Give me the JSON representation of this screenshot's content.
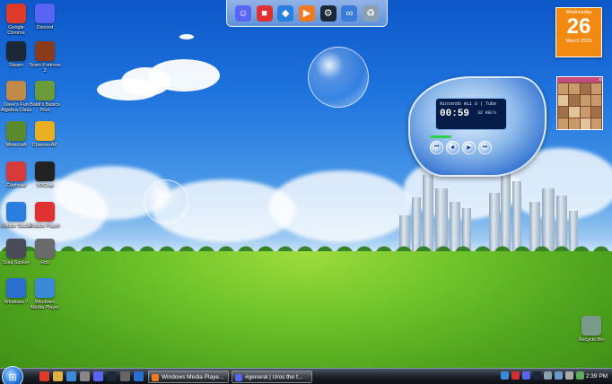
{
  "desktop_icons": [
    {
      "label": "Google Chrome",
      "icon": "chrome-icon",
      "color": "#dd3a2a"
    },
    {
      "label": "Discord",
      "icon": "discord-icon",
      "color": "#5865f2"
    },
    {
      "label": "Steam",
      "icon": "steam-icon",
      "color": "#1b2838"
    },
    {
      "label": "Team Fortress 2",
      "icon": "tf2-icon",
      "color": "#8b3a1a"
    },
    {
      "label": "Dave's Fun Algebra Class",
      "icon": "daves-algebra-icon",
      "color": "#c08a4a"
    },
    {
      "label": "Baldi's Basics Plus",
      "icon": "baldi-icon",
      "color": "#6b9a3a"
    },
    {
      "label": "Minecraft",
      "icon": "minecraft-icon",
      "color": "#5b8a2c"
    },
    {
      "label": "Cheese-AP",
      "icon": "cheese-icon",
      "color": "#e8b020"
    },
    {
      "label": "Cuphead",
      "icon": "cuphead-icon",
      "color": "#d63a3a"
    },
    {
      "label": "VRChat",
      "icon": "vrchat-icon",
      "color": "#222222"
    },
    {
      "label": "Roblox Studio",
      "icon": "roblox-studio-icon",
      "color": "#2a7ee0"
    },
    {
      "label": "Roblox Player",
      "icon": "roblox-player-icon",
      "color": "#e03030"
    },
    {
      "label": "Soul Sucker",
      "icon": "soul-sucker-icon",
      "color": "#4a4a5a"
    },
    {
      "label": "Roll",
      "icon": "roll-icon",
      "color": "#6a6a6a"
    },
    {
      "label": "Windows 7",
      "icon": "windows-icon",
      "color": "#2a6fd0"
    },
    {
      "label": "Windows Media Player",
      "icon": "media-player-icon",
      "color": "#3a8ad8"
    },
    {
      "label": "Recycle Bin",
      "icon": "recycle-bin-icon",
      "color": "#7a9a8a"
    }
  ],
  "dock_items": [
    {
      "icon": "discord-icon",
      "color": "#5865f2",
      "glyph": "☺"
    },
    {
      "icon": "roblox-icon",
      "color": "#e03030",
      "glyph": "■"
    },
    {
      "icon": "roblox-studio-icon",
      "color": "#2a7ee0",
      "glyph": "◆"
    },
    {
      "icon": "media-player-icon",
      "color": "#f07a20",
      "glyph": "▶"
    },
    {
      "icon": "steam-icon",
      "color": "#1b2838",
      "glyph": "⚙"
    },
    {
      "icon": "link-icon",
      "color": "#3a7ad8",
      "glyph": "∞"
    },
    {
      "icon": "recycle-bin-icon",
      "color": "#8aa0b0",
      "glyph": "♻"
    }
  ],
  "calendar": {
    "weekday": "Wednesday",
    "day": "26",
    "month_year": "March 2025"
  },
  "puzzle_gadget": {
    "controls": "x"
  },
  "media_player": {
    "track_title": "Nintendo Wii U | Tube",
    "time": "00:59",
    "rate": "32 KB/s"
  },
  "taskbar": {
    "start_icon": "windows-orb-icon",
    "quick_launch": [
      {
        "icon": "chrome-icon",
        "color": "#dd3a2a"
      },
      {
        "icon": "folder-icon",
        "color": "#e0b040"
      },
      {
        "icon": "internet-explorer-icon",
        "color": "#3a8ad8"
      },
      {
        "icon": "settings-icon",
        "color": "#888888"
      },
      {
        "icon": "discord-icon",
        "color": "#5865f2"
      },
      {
        "icon": "steam-icon",
        "color": "#1b2838"
      },
      {
        "icon": "gear-icon",
        "color": "#666666"
      },
      {
        "icon": "monitor-icon",
        "color": "#2a6fd0"
      }
    ],
    "tasks": [
      {
        "label": "Windows Media Playe...",
        "icon": "media-player-icon",
        "color": "#f07a20"
      },
      {
        "label": "#general | Uros the f...",
        "icon": "discord-icon",
        "color": "#5865f2"
      }
    ],
    "tray": [
      {
        "icon": "shield-icon",
        "color": "#3a8ad8"
      },
      {
        "icon": "alert-icon",
        "color": "#d03030"
      },
      {
        "icon": "discord-icon",
        "color": "#5865f2"
      },
      {
        "icon": "steam-icon",
        "color": "#1b2838"
      },
      {
        "icon": "network-icon",
        "color": "#8aa0b0"
      },
      {
        "icon": "chat-icon",
        "color": "#6a9ad0"
      },
      {
        "icon": "volume-icon",
        "color": "#aaaaaa"
      },
      {
        "icon": "battery-icon",
        "color": "#5ab05a"
      }
    ],
    "clock": "2:39 PM"
  }
}
